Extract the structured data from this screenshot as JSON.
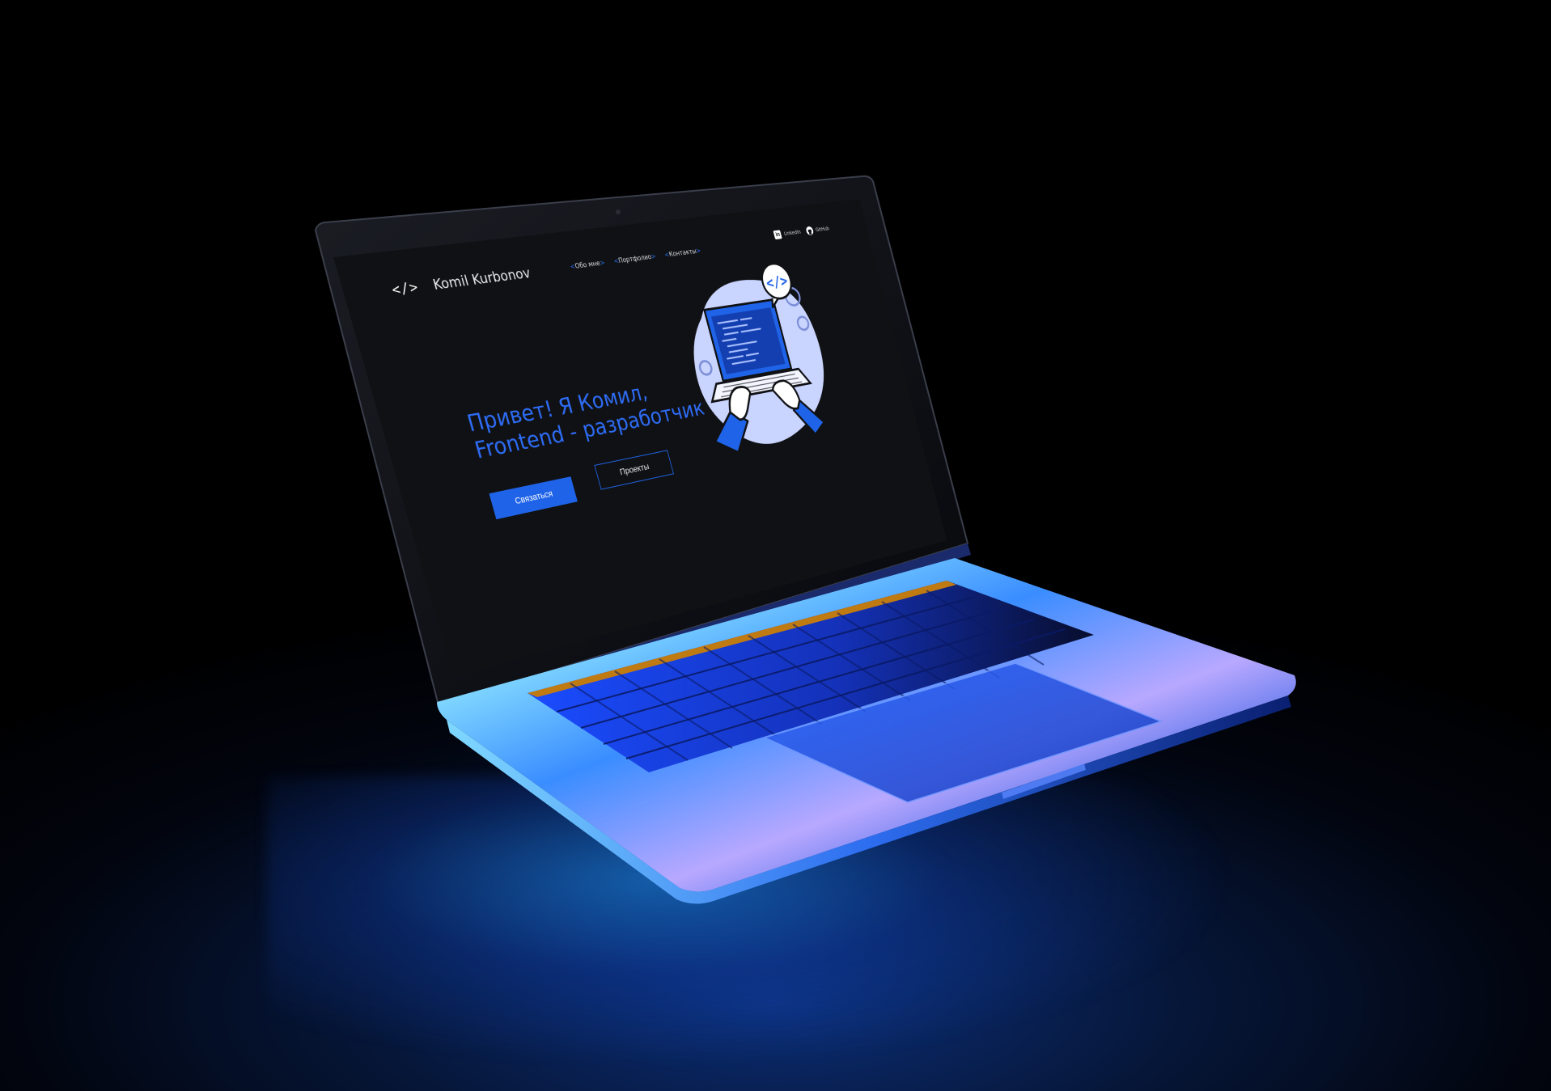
{
  "site": {
    "logo_mark": "</>",
    "logo_name": "Komil Kurbonov",
    "nav": [
      {
        "label": "Обо мне"
      },
      {
        "label": "Портфолио"
      },
      {
        "label": "Контакты"
      }
    ],
    "social": [
      {
        "label": "LinkedIn",
        "icon": "linkedin-icon"
      },
      {
        "label": "GitHub",
        "icon": "github-icon"
      }
    ],
    "hero": {
      "line1": "Привет! Я Комил,",
      "line2": "Frontend - разработчик"
    },
    "buttons": {
      "contact": "Связаться",
      "projects": "Проекты"
    },
    "colors": {
      "accent": "#1f63e8",
      "heading": "#2e6cf5",
      "background": "#101114"
    },
    "illustration": {
      "badge_icon": "code-brackets-icon",
      "subject": "hands-typing-on-laptop-icon"
    }
  }
}
